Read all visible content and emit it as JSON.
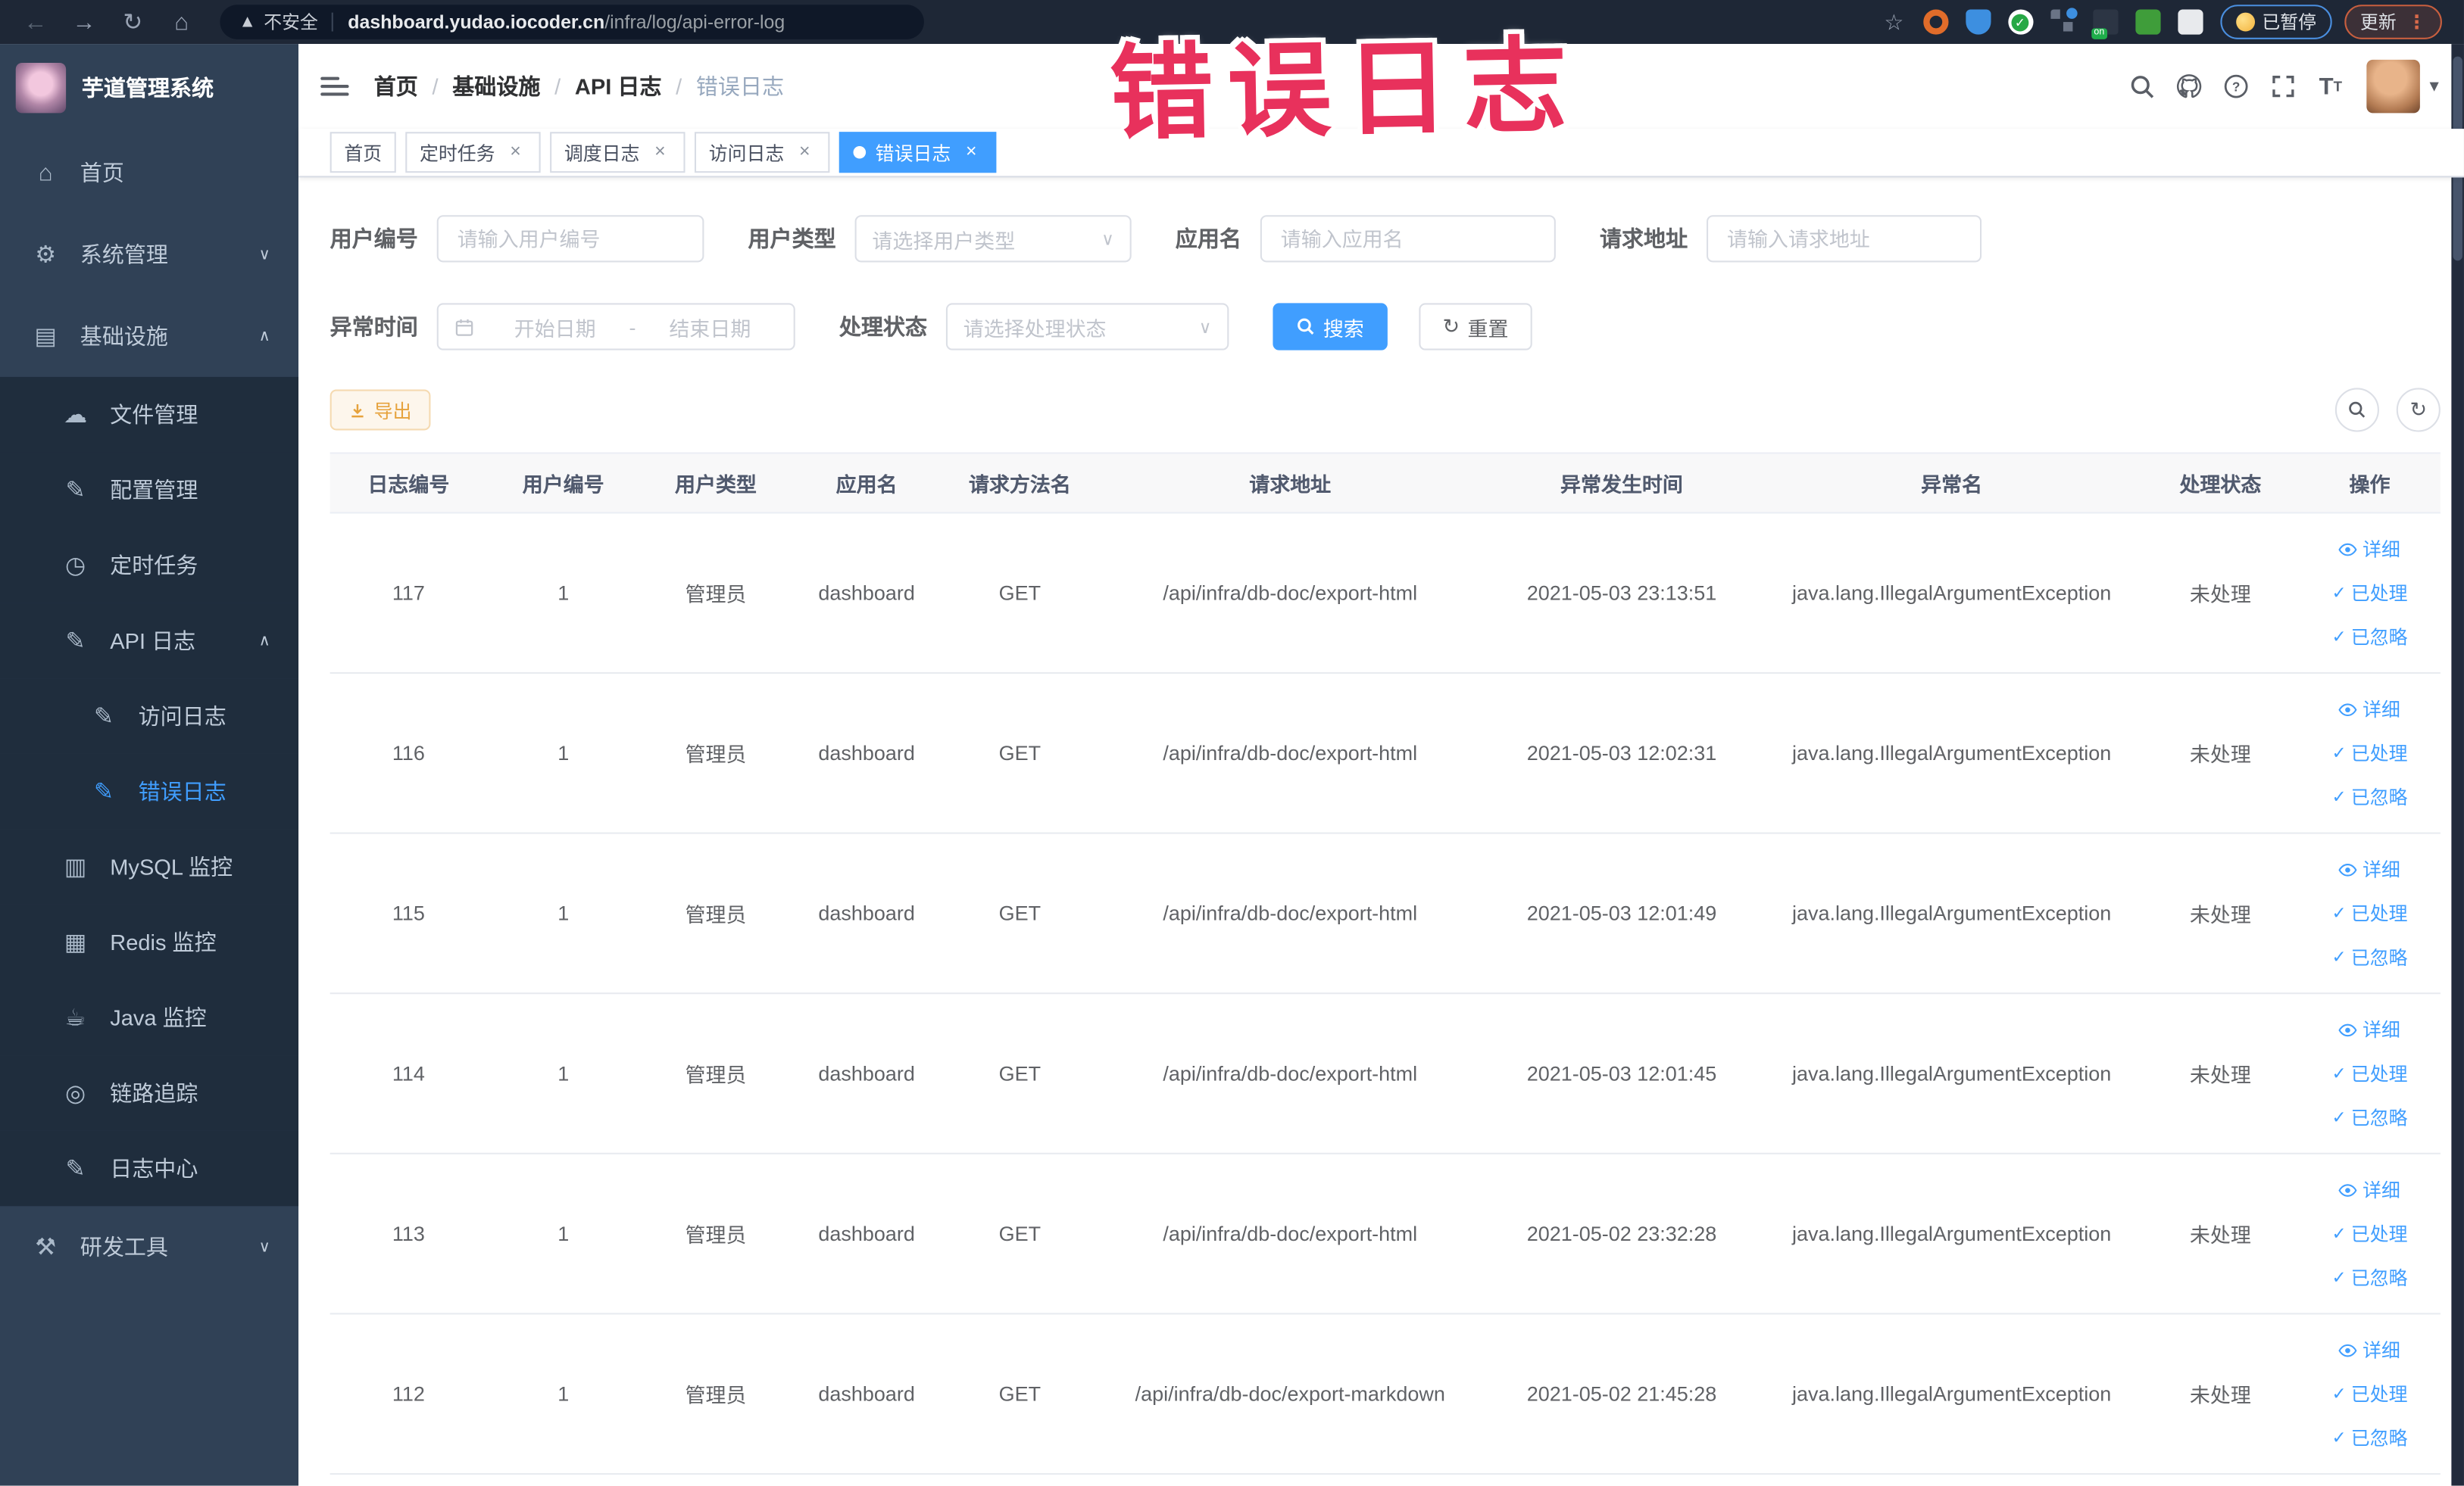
{
  "browser": {
    "security_label": "不安全",
    "url_host": "dashboard.yudao.iocoder.cn",
    "url_path": "/infra/log/api-error-log",
    "paused_badge": "已暂停",
    "update_button": "更新",
    "icons": [
      "back-icon",
      "forward-icon",
      "reload-icon",
      "home-icon",
      "warning-icon",
      "star-icon",
      "extension-icons",
      "menu-dots-icon"
    ]
  },
  "overlay": {
    "text": "错误日志"
  },
  "sidebar": {
    "logo_title": "芋道管理系统",
    "items": [
      {
        "label": "首页",
        "icon": "home-icon",
        "level": 1
      },
      {
        "label": "系统管理",
        "icon": "gear-icon",
        "level": 1,
        "chevron": "down"
      },
      {
        "label": "基础设施",
        "icon": "infra-icon",
        "level": 1,
        "chevron": "up"
      },
      {
        "label": "文件管理",
        "icon": "file-upload-icon",
        "level": 2
      },
      {
        "label": "配置管理",
        "icon": "config-edit-icon",
        "level": 2
      },
      {
        "label": "定时任务",
        "icon": "timer-icon",
        "level": 2
      },
      {
        "label": "API 日志",
        "icon": "api-log-icon",
        "level": 2,
        "chevron": "up"
      },
      {
        "label": "访问日志",
        "icon": "access-log-icon",
        "level": 3
      },
      {
        "label": "错误日志",
        "icon": "error-log-icon",
        "level": 3,
        "active": true
      },
      {
        "label": "MySQL 监控",
        "icon": "mysql-monitor-icon",
        "level": 2
      },
      {
        "label": "Redis 监控",
        "icon": "redis-monitor-icon",
        "level": 2
      },
      {
        "label": "Java 监控",
        "icon": "java-monitor-icon",
        "level": 2
      },
      {
        "label": "链路追踪",
        "icon": "trace-icon",
        "level": 2
      },
      {
        "label": "日志中心",
        "icon": "log-center-icon",
        "level": 2
      },
      {
        "label": "研发工具",
        "icon": "dev-tools-icon",
        "level": 1,
        "chevron": "down"
      }
    ]
  },
  "header": {
    "breadcrumb": [
      "首页",
      "基础设施",
      "API 日志",
      "错误日志"
    ],
    "icons": [
      "search-icon",
      "github-icon",
      "question-icon",
      "fullscreen-icon",
      "font-size-icon",
      "avatar",
      "chevron-down-icon"
    ]
  },
  "tabs": [
    {
      "label": "首页",
      "closable": false,
      "active": false
    },
    {
      "label": "定时任务",
      "closable": true,
      "active": false
    },
    {
      "label": "调度日志",
      "closable": true,
      "active": false
    },
    {
      "label": "访问日志",
      "closable": true,
      "active": false
    },
    {
      "label": "错误日志",
      "closable": true,
      "active": true
    }
  ],
  "filters": {
    "user_id": {
      "label": "用户编号",
      "placeholder": "请输入用户编号"
    },
    "user_type": {
      "label": "用户类型",
      "placeholder": "请选择用户类型"
    },
    "app_name": {
      "label": "应用名",
      "placeholder": "请输入应用名"
    },
    "request_url": {
      "label": "请求地址",
      "placeholder": "请输入请求地址"
    },
    "exception_time": {
      "label": "异常时间",
      "start_placeholder": "开始日期",
      "separator": "-",
      "end_placeholder": "结束日期"
    },
    "process_status": {
      "label": "处理状态",
      "placeholder": "请选择处理状态"
    },
    "search_button": "搜索",
    "reset_button": "重置"
  },
  "toolbar": {
    "export_button": "导出"
  },
  "table": {
    "columns": [
      "日志编号",
      "用户编号",
      "用户类型",
      "应用名",
      "请求方法名",
      "请求地址",
      "异常发生时间",
      "异常名",
      "处理状态",
      "操作"
    ],
    "actions": [
      "详细",
      "已处理",
      "已忽略"
    ],
    "rows": [
      {
        "id": "117",
        "user_id": "1",
        "user_type": "管理员",
        "app": "dashboard",
        "method": "GET",
        "url": "/api/infra/db-doc/export-html",
        "time": "2021-05-03 23:13:51",
        "exception": "java.lang.IllegalArgumentException",
        "status": "未处理"
      },
      {
        "id": "116",
        "user_id": "1",
        "user_type": "管理员",
        "app": "dashboard",
        "method": "GET",
        "url": "/api/infra/db-doc/export-html",
        "time": "2021-05-03 12:02:31",
        "exception": "java.lang.IllegalArgumentException",
        "status": "未处理"
      },
      {
        "id": "115",
        "user_id": "1",
        "user_type": "管理员",
        "app": "dashboard",
        "method": "GET",
        "url": "/api/infra/db-doc/export-html",
        "time": "2021-05-03 12:01:49",
        "exception": "java.lang.IllegalArgumentException",
        "status": "未处理"
      },
      {
        "id": "114",
        "user_id": "1",
        "user_type": "管理员",
        "app": "dashboard",
        "method": "GET",
        "url": "/api/infra/db-doc/export-html",
        "time": "2021-05-03 12:01:45",
        "exception": "java.lang.IllegalArgumentException",
        "status": "未处理"
      },
      {
        "id": "113",
        "user_id": "1",
        "user_type": "管理员",
        "app": "dashboard",
        "method": "GET",
        "url": "/api/infra/db-doc/export-html",
        "time": "2021-05-02 23:32:28",
        "exception": "java.lang.IllegalArgumentException",
        "status": "未处理"
      },
      {
        "id": "112",
        "user_id": "1",
        "user_type": "管理员",
        "app": "dashboard",
        "method": "GET",
        "url": "/api/infra/db-doc/export-markdown",
        "time": "2021-05-02 21:45:28",
        "exception": "java.lang.IllegalArgumentException",
        "status": "未处理"
      }
    ],
    "colors": {
      "accent": "#409EFF",
      "warning": "#E6A23C",
      "sidebar": "#304156",
      "submenu": "#1f2d3d",
      "overlay_red": "#e8315c"
    }
  }
}
